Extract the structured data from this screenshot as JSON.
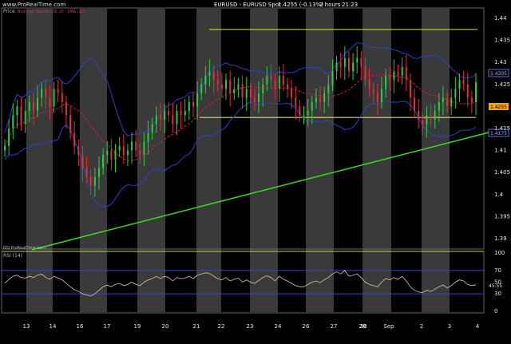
{
  "header": {
    "logo_text": "www.ProRealTime.com",
    "title": "EURUSD - EURUSD Spot",
    "price": "1.4255 (-0.13%)",
    "timeframe": "2 hours",
    "time": "21:23"
  },
  "price_panel": {
    "label": "Price",
    "legend_text": "Bollinger Bands (20, 2) · SMA (20)",
    "resistance_level": 1.4375,
    "support_level": 1.4175,
    "current_price_label": "1.4255",
    "upper_marker_label": "1.4305",
    "lower_marker_label": "1.4175",
    "colors": {
      "bull": "#2ecc40",
      "bear": "#e0303a",
      "bands": "#2d40c8",
      "sma": "#cc2030",
      "hline": "#e6e23a",
      "trend": "#36e020",
      "stripe": "#3a3a3a",
      "price_badge": "#f2a30a"
    }
  },
  "rsi_panel": {
    "label": "RSI (14)",
    "small_label": "RSI ProRealTime.com",
    "current_value_label": "45.55",
    "colors": {
      "line": "#d8cc9a",
      "level": "#3546d0"
    }
  },
  "x_axis": {
    "labels": [
      "13",
      "14",
      "16",
      "17",
      "19",
      "20",
      "21",
      "22",
      "23",
      "24",
      "26",
      "27",
      "28",
      "30",
      "Sep",
      "2",
      "3",
      "4"
    ]
  },
  "chart_data": [
    {
      "type": "line",
      "title": "EURUSD - EURUSD Spot",
      "series": [
        {
          "name": "Price",
          "values": [
            1.411,
            1.415,
            1.418,
            1.42,
            1.416,
            1.419,
            1.421,
            1.419,
            1.422,
            1.424,
            1.422,
            1.42,
            1.424,
            1.423,
            1.421,
            1.418,
            1.414,
            1.411,
            1.409,
            1.406,
            1.404,
            1.402,
            1.404,
            1.406,
            1.409,
            1.41,
            1.408,
            1.41,
            1.411,
            1.409,
            1.41,
            1.412,
            1.41,
            1.409,
            1.412,
            1.414,
            1.416,
            1.418,
            1.417,
            1.419,
            1.418,
            1.416,
            1.419,
            1.418,
            1.419,
            1.421,
            1.42,
            1.423,
            1.425,
            1.427,
            1.428,
            1.426,
            1.425,
            1.424,
            1.426,
            1.423,
            1.424,
            1.425,
            1.422,
            1.424,
            1.422,
            1.421,
            1.423,
            1.425,
            1.427,
            1.426,
            1.424,
            1.427,
            1.425,
            1.424,
            1.422,
            1.42,
            1.418,
            1.418,
            1.419,
            1.421,
            1.422,
            1.421,
            1.423,
            1.425,
            1.428,
            1.43,
            1.429,
            1.431,
            1.428,
            1.43,
            1.431,
            1.429,
            1.426,
            1.424,
            1.423,
            1.421,
            1.424,
            1.427,
            1.426,
            1.428,
            1.427,
            1.429,
            1.426,
            1.422,
            1.419,
            1.417,
            1.416,
            1.418,
            1.417,
            1.419,
            1.421,
            1.422,
            1.42,
            1.422,
            1.424,
            1.426,
            1.425,
            1.422,
            1.421,
            1.4255
          ]
        }
      ],
      "y_ticks": [
        1.44,
        1.435,
        1.43,
        1.425,
        1.42,
        1.415,
        1.41,
        1.405,
        1.4,
        1.395,
        1.39
      ],
      "ylim": [
        1.388,
        1.442
      ],
      "grid": false
    },
    {
      "type": "line",
      "title": "RSI (14)",
      "series": [
        {
          "name": "RSI (14)",
          "values": [
            48,
            55,
            60,
            62,
            58,
            57,
            60,
            58,
            62,
            64,
            58,
            55,
            60,
            57,
            54,
            48,
            42,
            37,
            34,
            30,
            28,
            26,
            30,
            36,
            42,
            45,
            42,
            46,
            48,
            44,
            46,
            50,
            46,
            44,
            50,
            54,
            56,
            60,
            56,
            60,
            58,
            52,
            58,
            56,
            57,
            60,
            56,
            62,
            64,
            66,
            65,
            60,
            56,
            54,
            58,
            52,
            55,
            57,
            50,
            54,
            50,
            48,
            53,
            58,
            61,
            58,
            52,
            60,
            55,
            52,
            48,
            44,
            42,
            42,
            46,
            50,
            52,
            49,
            54,
            58,
            64,
            68,
            64,
            70,
            60,
            62,
            64,
            58,
            50,
            46,
            44,
            42,
            50,
            56,
            54,
            58,
            55,
            60,
            52,
            42,
            36,
            33,
            32,
            36,
            34,
            38,
            42,
            45,
            40,
            44,
            50,
            54,
            52,
            46,
            44,
            45.55
          ]
        }
      ],
      "y_ticks": [
        100,
        70,
        50,
        30,
        0
      ],
      "ylim": [
        0,
        100
      ],
      "grid": false
    }
  ]
}
